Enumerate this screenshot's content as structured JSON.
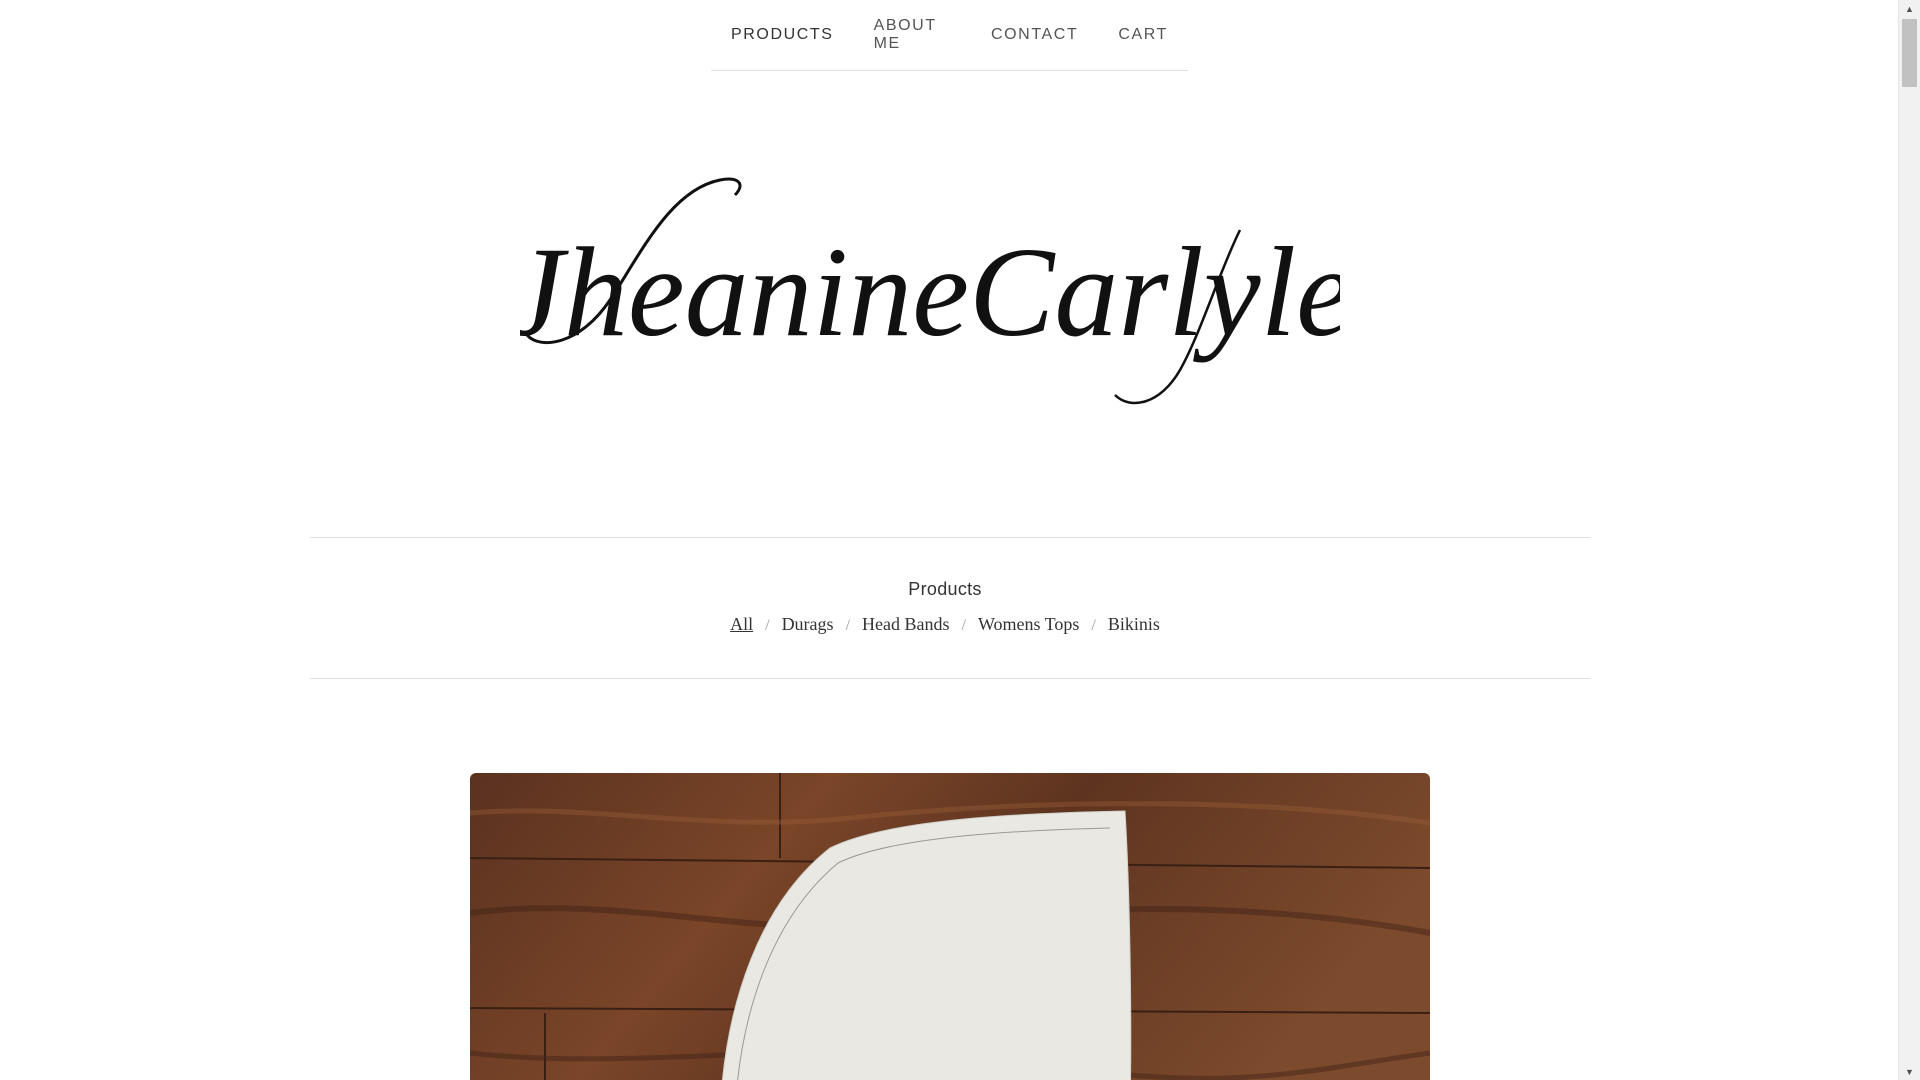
{
  "nav": {
    "items": [
      {
        "label": "PRODUCTS"
      },
      {
        "label": "ABOUT ME"
      },
      {
        "label": "CONTACT"
      },
      {
        "label": "CART"
      }
    ]
  },
  "logo": {
    "text": "JheanineCarlyle"
  },
  "categories": {
    "title": "Products",
    "items": [
      {
        "label": "All",
        "selected": true
      },
      {
        "label": "Durags"
      },
      {
        "label": "Head Bands"
      },
      {
        "label": "Womens Tops"
      },
      {
        "label": "Bikinis"
      }
    ],
    "separator": "/"
  },
  "colors": {
    "wood_dark": "#4a2a1a",
    "wood_mid": "#6e3f26",
    "wood_light": "#8a5434",
    "paper": "#e9e8e3"
  },
  "scrollbar": {
    "up_icon": "triangle-up-icon",
    "down_icon": "triangle-down-icon",
    "up_glyph": "▲",
    "down_glyph": "▼"
  }
}
